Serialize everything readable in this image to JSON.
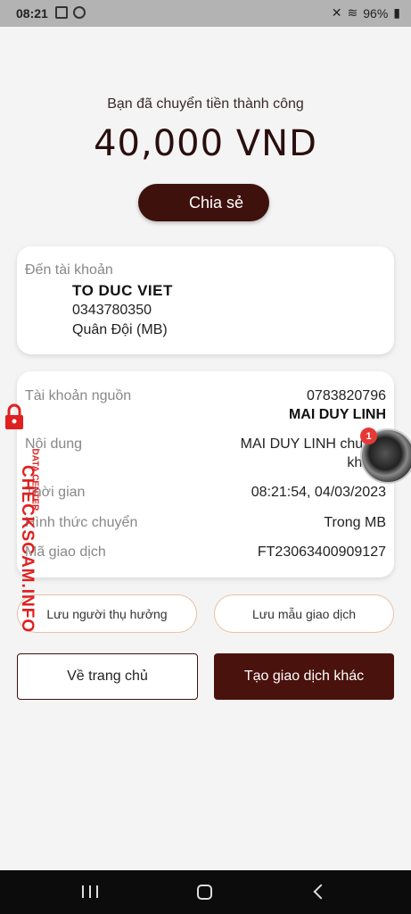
{
  "status_bar": {
    "time": "08:21",
    "battery": "96%",
    "icons": [
      "gallery-icon",
      "messenger-icon",
      "mute-icon",
      "wifi-icon",
      "signal-icon",
      "battery-icon"
    ]
  },
  "result": {
    "message": "Bạn đã chuyển tiền thành công",
    "amount": "40,000 VND",
    "share_label": "Chia sẻ"
  },
  "recipient": {
    "label": "Đến tài khoản",
    "name": "TO DUC VIET",
    "account": "0343780350",
    "bank": "Quân Đội (MB)"
  },
  "details": {
    "source_label": "Tài khoản nguồn",
    "source_account": "0783820796",
    "source_name": "MAI DUY LINH",
    "content_label": "Nội dung",
    "content_line1": "MAI DUY LINH chuyển",
    "content_line2": "khoản",
    "time_label": "Thời gian",
    "time_value": "08:21:54, 04/03/2023",
    "method_label": "Hình thức chuyển",
    "method_value": "Trong MB",
    "txn_label": "Mã giao dịch",
    "txn_value": "FT23063400909127"
  },
  "actions": {
    "save_recipient": "Lưu người thụ hưởng",
    "save_template": "Lưu mẫu giao dịch",
    "home": "Về trang chủ",
    "new_transaction": "Tạo giao dịch khác"
  },
  "watermark": {
    "big": "CHECKSCAM.INFO",
    "small": "DATA CENTER",
    "color": "#e02020"
  },
  "chat_head": {
    "badge_count": "1"
  },
  "colors": {
    "brand": "#3e110c",
    "background": "#f4f4f4"
  }
}
